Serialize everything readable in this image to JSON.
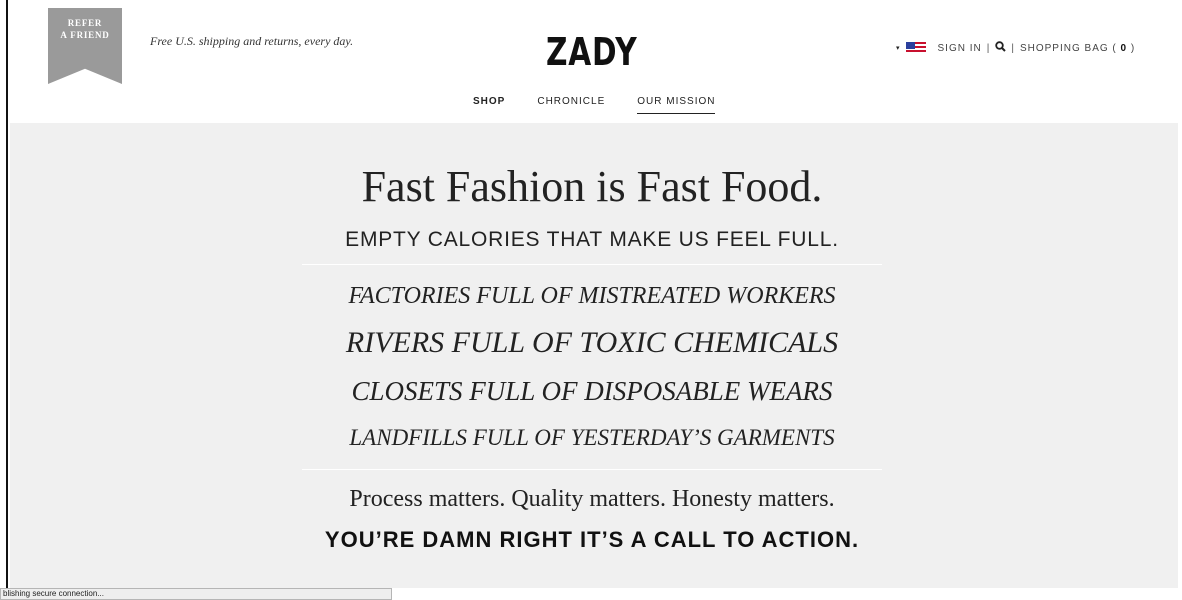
{
  "header": {
    "refer_line1": "REFER",
    "refer_line2": "A FRIEND",
    "promo": "Free U.S. shipping and returns, every day.",
    "logo": "ZADY",
    "caret": "▾",
    "sign_in": "SIGN IN",
    "sep": "|",
    "shopping_bag_label": "SHOPPING BAG (",
    "bag_count": "0",
    "shopping_bag_close": ")"
  },
  "nav": [
    {
      "label": "SHOP"
    },
    {
      "label": "CHRONICLE"
    },
    {
      "label": "OUR MISSION"
    }
  ],
  "main": {
    "headline": "Fast Fashion is Fast Food.",
    "subheadline": "EMPTY CALORIES THAT MAKE US FEEL FULL.",
    "lines": [
      "FACTORIES FULL OF MISTREATED WORKERS",
      "RIVERS FULL OF TOXIC CHEMICALS",
      "CLOSETS FULL OF DISPOSABLE WEARS",
      "LANDFILLS FULL OF YESTERDAY’S GARMENTS"
    ],
    "process": "Process matters. Quality matters. Honesty matters.",
    "call_to_action": "YOU’RE DAMN RIGHT IT’S A CALL TO ACTION."
  },
  "status": {
    "text": "blishing secure connection..."
  },
  "colors": {
    "ribbon": "#9a9a9a",
    "panel_bg": "#f0f0f0",
    "text": "#222222"
  }
}
